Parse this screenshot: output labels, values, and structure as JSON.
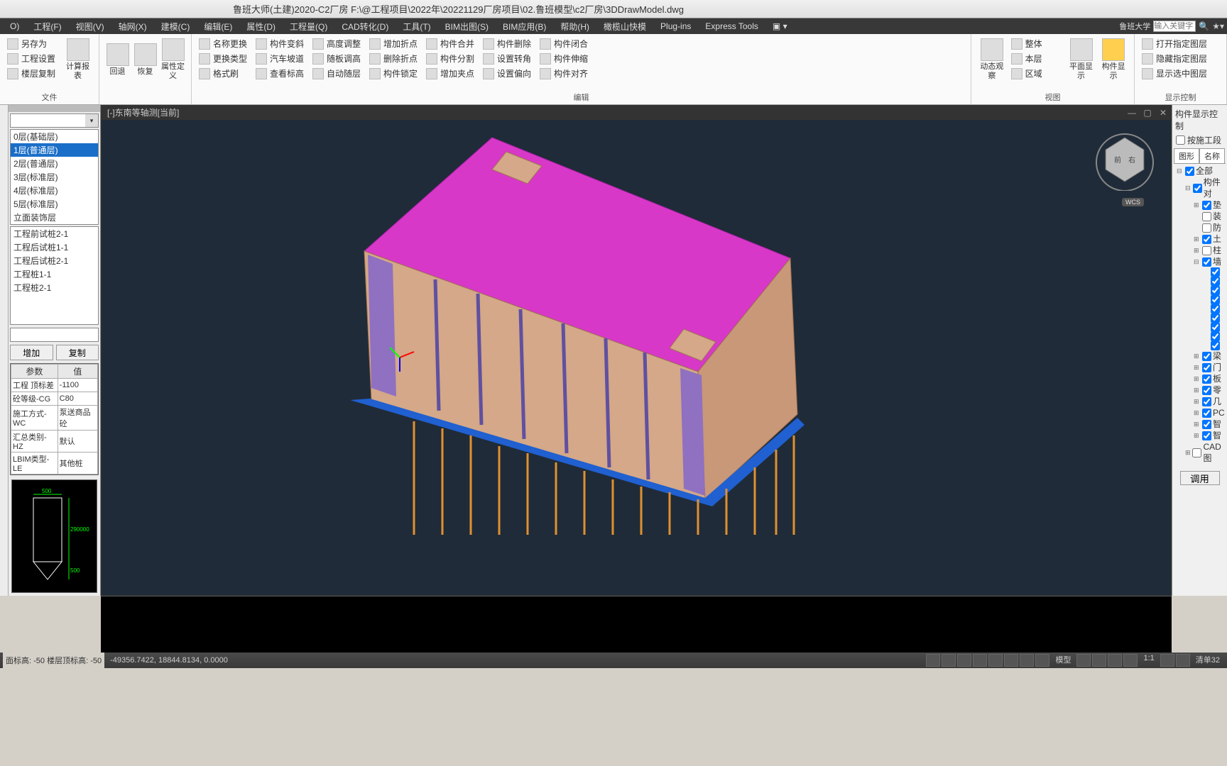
{
  "title": "鲁班大师(土建)2020-C2厂房    F:\\@工程项目\\2022年\\20221129厂房项目\\02.鲁班模型\\c2厂房\\3DDrawModel.dwg",
  "menu": {
    "items": [
      "O)",
      "工程(F)",
      "视图(V)",
      "轴网(X)",
      "建模(C)",
      "编辑(E)",
      "属性(D)",
      "工程量(Q)",
      "CAD转化(D)",
      "工具(T)",
      "BIM出图(S)",
      "BIM应用(B)",
      "帮助(H)",
      "橄榄山快模",
      "Plug-ins",
      "Express Tools"
    ],
    "search_label": "鲁班大学",
    "search_placeholder": "输入关键字"
  },
  "ribbon": {
    "file": {
      "save_as": "另存为",
      "settings": "工程设置",
      "floor_copy": "楼层复制",
      "report": "计算报表",
      "label": "文件"
    },
    "undo": "回退",
    "redo": "恢复",
    "attr": "属性定义",
    "edit_btns": [
      "名称更换",
      "更换类型",
      "格式刷",
      "构件变斜",
      "汽车坡道",
      "查看标高",
      "高度调整",
      "随板调高",
      "自动随层",
      "增加折点",
      "删除折点",
      "构件锁定",
      "构件合并",
      "构件分割",
      "增加夹点",
      "构件删除",
      "设置转角",
      "设置偏向",
      "构件闭合",
      "构件伸缩",
      "构件对齐"
    ],
    "edit_label": "编辑",
    "view": {
      "dynamic": "动态观察",
      "overall": "整体",
      "this_floor": "本层",
      "area": "区域",
      "flat": "平面显示",
      "comp": "构件显示",
      "label": "视图"
    },
    "display": {
      "open": "打开指定图层",
      "hide": "隐藏指定图层",
      "show": "显示选中图层",
      "label": "显示控制"
    }
  },
  "viewport": {
    "label": "[-]东南等轴测[当前]",
    "wcs": "WCS"
  },
  "floor_dropdown": {
    "items": [
      "0层(基础层)",
      "1层(普通层)",
      "2层(普通层)",
      "3层(标准层)",
      "4层(标准层)",
      "5层(标准层)",
      "立面装饰层"
    ],
    "selected_index": 1
  },
  "tree_items": [
    "工程前试桩2-1",
    "工程后试桩1-1",
    "工程后试桩2-1",
    "工程桩1-1",
    "工程桩2-1"
  ],
  "buttons": {
    "add": "增加",
    "copy": "复制"
  },
  "props": {
    "header_param": "参数",
    "header_value": "值",
    "rows": [
      [
        "工程 顶标差",
        "-1100"
      ],
      [
        "砼等级-CG",
        "C80"
      ],
      [
        "施工方式-WC",
        "泵送商品砼"
      ],
      [
        "汇总类别-HZ",
        "默认"
      ],
      [
        "LBIM类型-LE",
        "其他桩"
      ]
    ]
  },
  "preview_dims": {
    "w": "500",
    "h": "290000",
    "b": "500"
  },
  "right": {
    "title": "构件显示控制",
    "by_stage": "按施工段",
    "tab1": "图形",
    "tab2": "名称",
    "root": "全部",
    "nodes": [
      "构件对",
      "垫",
      "装",
      "防",
      "土",
      "柱",
      "墙",
      "梁",
      "门",
      "板",
      "零",
      "几",
      "PC",
      "智",
      "智",
      "CAD图"
    ]
  },
  "apply": "调用",
  "status": {
    "left1": "面标高: -50",
    "left2": "楼层顶标高: -50",
    "coords": "-49356.7422, 18844.8134, 0.0000",
    "model": "模型",
    "scale": "1:1",
    "list": "清单32"
  }
}
